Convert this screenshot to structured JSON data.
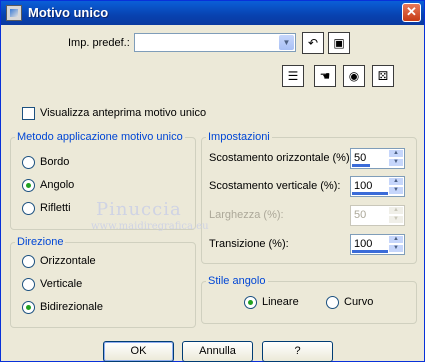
{
  "window": {
    "title": "Motivo unico",
    "close_glyph": "✕"
  },
  "preset": {
    "label": "Imp. predef.:",
    "value": "",
    "arrow": "▼"
  },
  "toolbar": [
    {
      "icon": "undo-icon",
      "glyph": "↶"
    },
    {
      "icon": "save-icon",
      "glyph": "▣"
    },
    {
      "icon": "list-icon",
      "glyph": "☰"
    },
    {
      "icon": "hand-icon",
      "glyph": "☚"
    },
    {
      "icon": "eye-icon",
      "glyph": "◉"
    },
    {
      "icon": "dice-icon",
      "glyph": "⚄"
    }
  ],
  "preview_label": "Visualizza anteprima motivo unico",
  "method_group": {
    "title": "Metodo applicazione motivo unico",
    "options": [
      "Bordo",
      "Angolo",
      "Rifletti"
    ],
    "selected": "Angolo"
  },
  "direction_group": {
    "title": "Direzione",
    "options": [
      "Orizzontale",
      "Verticale",
      "Bidirezionale"
    ],
    "selected": "Bidirezionale"
  },
  "settings_group": {
    "title": "Impostazioni",
    "fields": [
      {
        "label": "Scostamento orizzontale (%):",
        "value": "50",
        "level": 50,
        "enabled": true
      },
      {
        "label": "Scostamento verticale (%):",
        "value": "100",
        "level": 100,
        "enabled": true
      },
      {
        "label": "Larghezza (%):",
        "value": "50",
        "level": 50,
        "enabled": false
      },
      {
        "label": "Transizione (%):",
        "value": "100",
        "level": 100,
        "enabled": true
      }
    ]
  },
  "corner_group": {
    "title": "Stile angolo",
    "options": [
      "Lineare",
      "Curvo"
    ],
    "selected": "Lineare"
  },
  "buttons": {
    "ok": "OK",
    "cancel": "Annulla",
    "help": "?"
  },
  "watermark": {
    "line1": "Pinuccia",
    "line2": "www.maidiregrafica.eu"
  },
  "colors": {
    "title_bar": "#0a5fd8",
    "group_title": "#0046d5",
    "radio_dot": "#21a121"
  }
}
